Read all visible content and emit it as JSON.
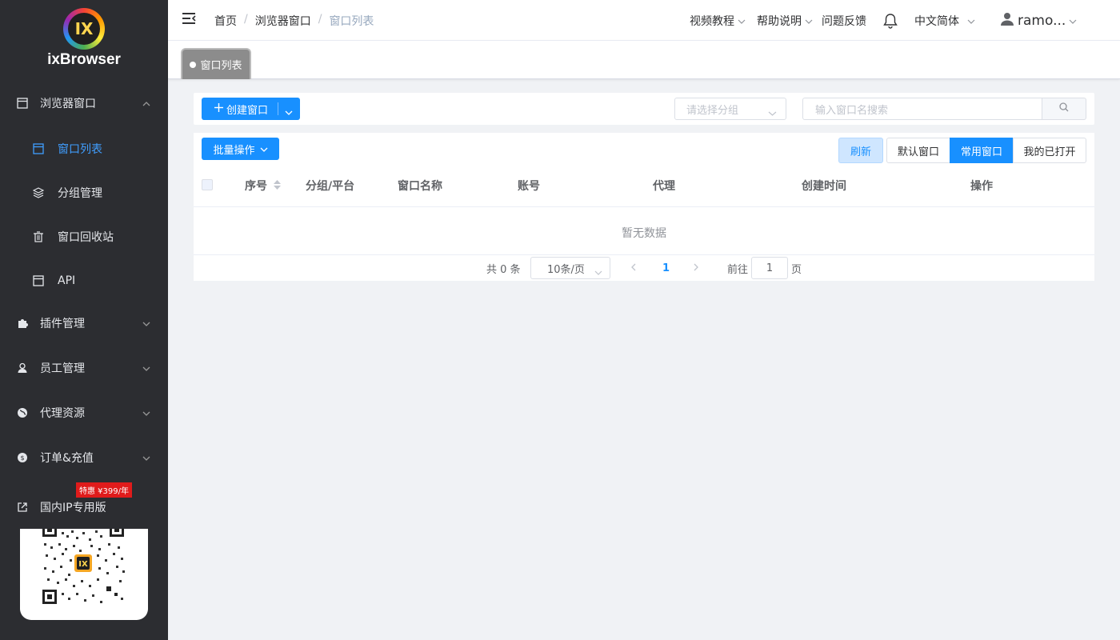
{
  "brand": {
    "logo_letters": "IX",
    "name": "ixBrowser"
  },
  "sidebar": {
    "browser_group": "浏览器窗口",
    "window_list": "窗口列表",
    "group_manage": "分组管理",
    "recycle_bin": "窗口回收站",
    "api": "API",
    "plugins": "插件管理",
    "staff": "员工管理",
    "proxy": "代理资源",
    "orders": "订单&充值",
    "domestic_ip": "国内IP专用版",
    "promo_badge": "特惠 ¥399/年"
  },
  "header": {
    "breadcrumb": [
      "首页",
      "浏览器窗口",
      "窗口列表"
    ],
    "video_tutorial": "视频教程",
    "help": "帮助说明",
    "feedback": "问题反馈",
    "language": "中文简体",
    "user": "ramo..."
  },
  "tabs": {
    "active_tab": "窗口列表"
  },
  "toolbar": {
    "create_window": "创建窗口",
    "group_select_placeholder": "请选择分组",
    "search_placeholder": "输入窗口名搜索"
  },
  "table_toolbar": {
    "batch_ops": "批量操作",
    "refresh": "刷新",
    "default_window": "默认窗口",
    "common_window": "常用窗口",
    "my_opened": "我的已打开"
  },
  "table": {
    "columns": [
      "序号",
      "分组/平台",
      "窗口名称",
      "账号",
      "代理",
      "创建时间",
      "操作"
    ],
    "empty_text": "暂无数据"
  },
  "pagination": {
    "total": "共 0 条",
    "page_size": "10条/页",
    "current_page": "1",
    "goto_label": "前往",
    "goto_value": "1",
    "page_unit": "页"
  },
  "colors": {
    "primary": "#1890ff",
    "sidebar_bg": "#2c2d31",
    "active_menu": "#409eff"
  }
}
